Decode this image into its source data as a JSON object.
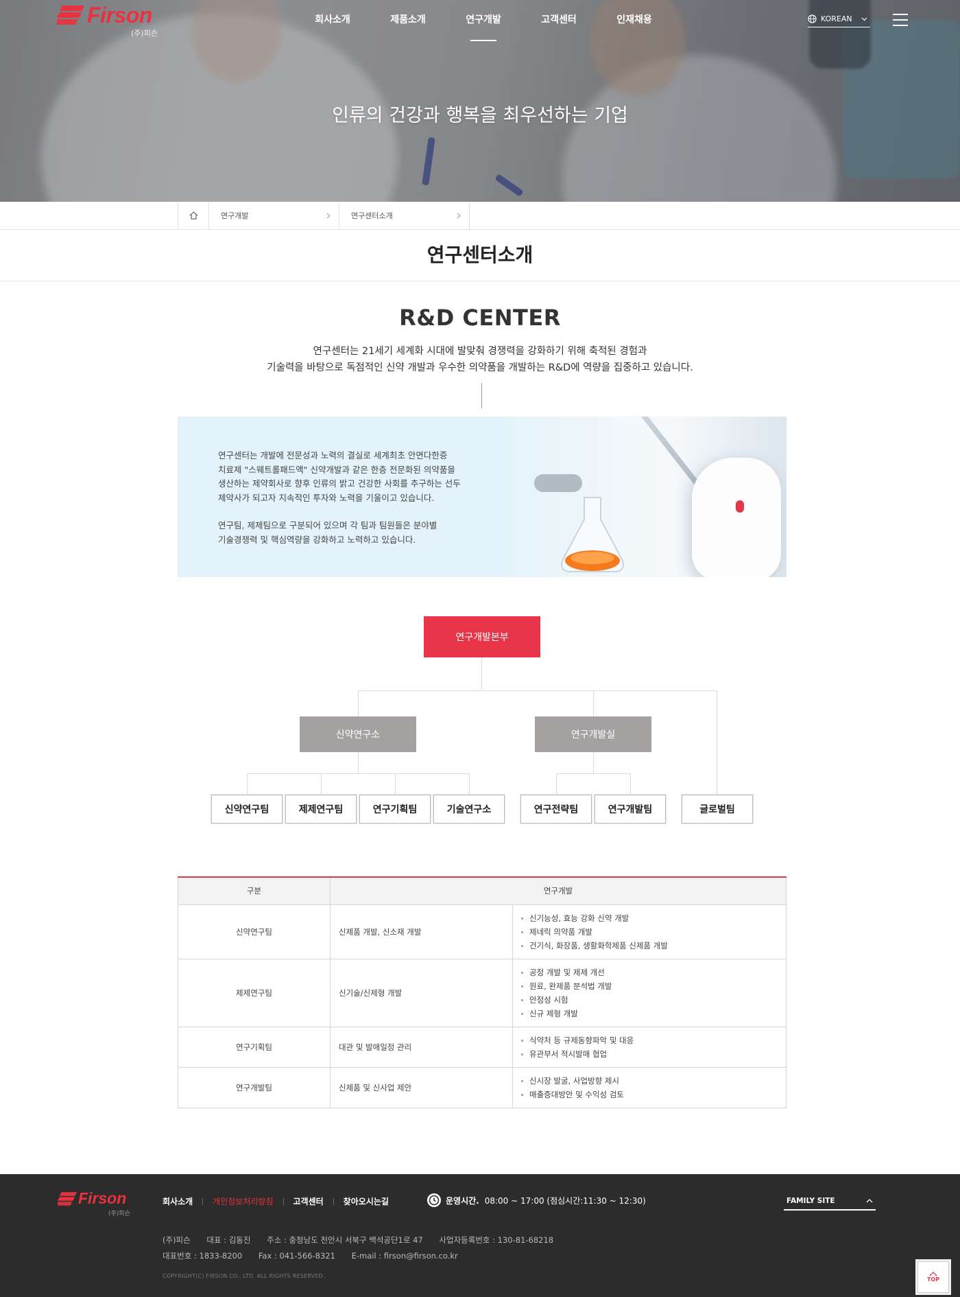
{
  "brand": {
    "name": "Firson",
    "sub": "(주)피슨",
    "red": "#e8323f"
  },
  "nav": {
    "items": [
      "회사소개",
      "제품소개",
      "연구개발",
      "고객센터",
      "인재채용"
    ],
    "active": "연구개발",
    "language": "KOREAN"
  },
  "hero": {
    "title": "인류의 건강과 행복을 최우선하는 기업"
  },
  "breadcrumb": {
    "items": [
      "연구개발",
      "연구센터소개"
    ]
  },
  "page": {
    "title": "연구센터소개"
  },
  "intro": {
    "heading": "R&D CENTER",
    "line1": "연구센터는 21세기 세계화 시대에 발맞춰 경쟁력을 강화하기 위해 축적된 경험과",
    "line2": "기술력을 바탕으로 독점적인 신약 개발과 우수한 의약품을 개발하는 R&D에 역량을 집중하고 있습니다."
  },
  "infobox": {
    "p1": [
      "연구센터는 개발에 전문성과 노력의 결실로 세계최초 안면다한증",
      "치료제 \"스웨트롤패드액\" 신약개발과 같은 한층 전문화된 의약품을",
      "생산하는 제약회사로 향후 인류의 밝고 건강한 사회를 추구하는 선두",
      "제약사가 되고자 지속적인 투자와 노력을 기울이고 있습니다."
    ],
    "p2": [
      "연구팀, 제제팀으로 구분되어 있으며 각 팀과 팀원들은 분야별",
      "기술경쟁력 및 핵심역량을 강화하고 노력하고 있습니다."
    ]
  },
  "org": {
    "top": "연구개발본부",
    "mid": [
      "신약연구소",
      "연구개발실"
    ],
    "leaves": [
      "신약연구팀",
      "제제연구팀",
      "연구기획팀",
      "기술연구소",
      "연구전략팀",
      "연구개발팀",
      "글로벌팀"
    ],
    "colors": {
      "top": "#e8354a",
      "mid": "#a6a1a1"
    }
  },
  "table": {
    "headers": [
      "구분",
      "연구개발"
    ],
    "rows": [
      {
        "team": "신약연구팀",
        "area": "신제품 개발, 신소재 개발",
        "items": [
          "신기능성, 효능 강화 신약 개발",
          "제네릭 의약품 개발",
          "건기식, 화장품, 생활화학제품 신제품 개발"
        ]
      },
      {
        "team": "제제연구팀",
        "area": "신기술/신제형 개발",
        "items": [
          "공정 개발 및 제제 개선",
          "원료, 완제품 분석법 개발",
          "안정성 시험",
          "신규 제형 개발"
        ]
      },
      {
        "team": "연구기획팀",
        "area": "대관 및 발매일정 관리",
        "items": [
          "식약처 등 규제동향파악 및 대응",
          "유관부서 적시발매 협업"
        ]
      },
      {
        "team": "연구개발팀",
        "area": "신제품 및 신사업 제안",
        "items": [
          "신시장 발굴, 사업방향 제시",
          "매출증대방안 및 수익성 검토"
        ]
      }
    ]
  },
  "footer": {
    "links": [
      "회사소개",
      "개인정보처리방침",
      "고객센터",
      "찾아오시는길"
    ],
    "hours_label": "운영시간.",
    "hours": "08:00 ~ 17:00 (점심시간:11:30 ~ 12:30)",
    "family_site": "FAMILY SITE",
    "company": "(주)피슨",
    "ceo": "대표 : 김동진",
    "address": "주소 : 충청남도 천안시 서북구 백석공단1로 47",
    "bizno": "사업자등록번호 : 130-81-68218",
    "tel": "대표번호 : 1833-8200",
    "fax": "Fax : 041-566-8321",
    "email": "E-mail : firson@firson.co.kr",
    "copyright": "COPYRIGHT(C) FIRSON CO., LTD. ALL RIGHTS RESERVED.",
    "top_label": "TOP"
  }
}
